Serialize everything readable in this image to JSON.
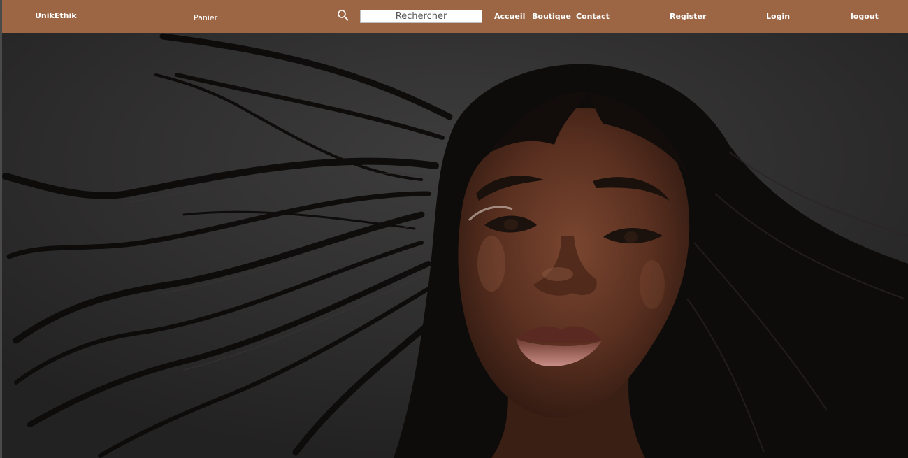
{
  "navbar": {
    "brand": "UnikEthik",
    "cart_label": "Panier",
    "search_placeholder": "Rechercher",
    "links": {
      "home": "Accueil",
      "shop": "Boutique",
      "contact": "Contact"
    },
    "auth": {
      "register": "Register",
      "login": "Login",
      "logout": "logout"
    },
    "background_color": "#9c6644"
  },
  "hero": {
    "icon": "woman-portrait-photo"
  }
}
